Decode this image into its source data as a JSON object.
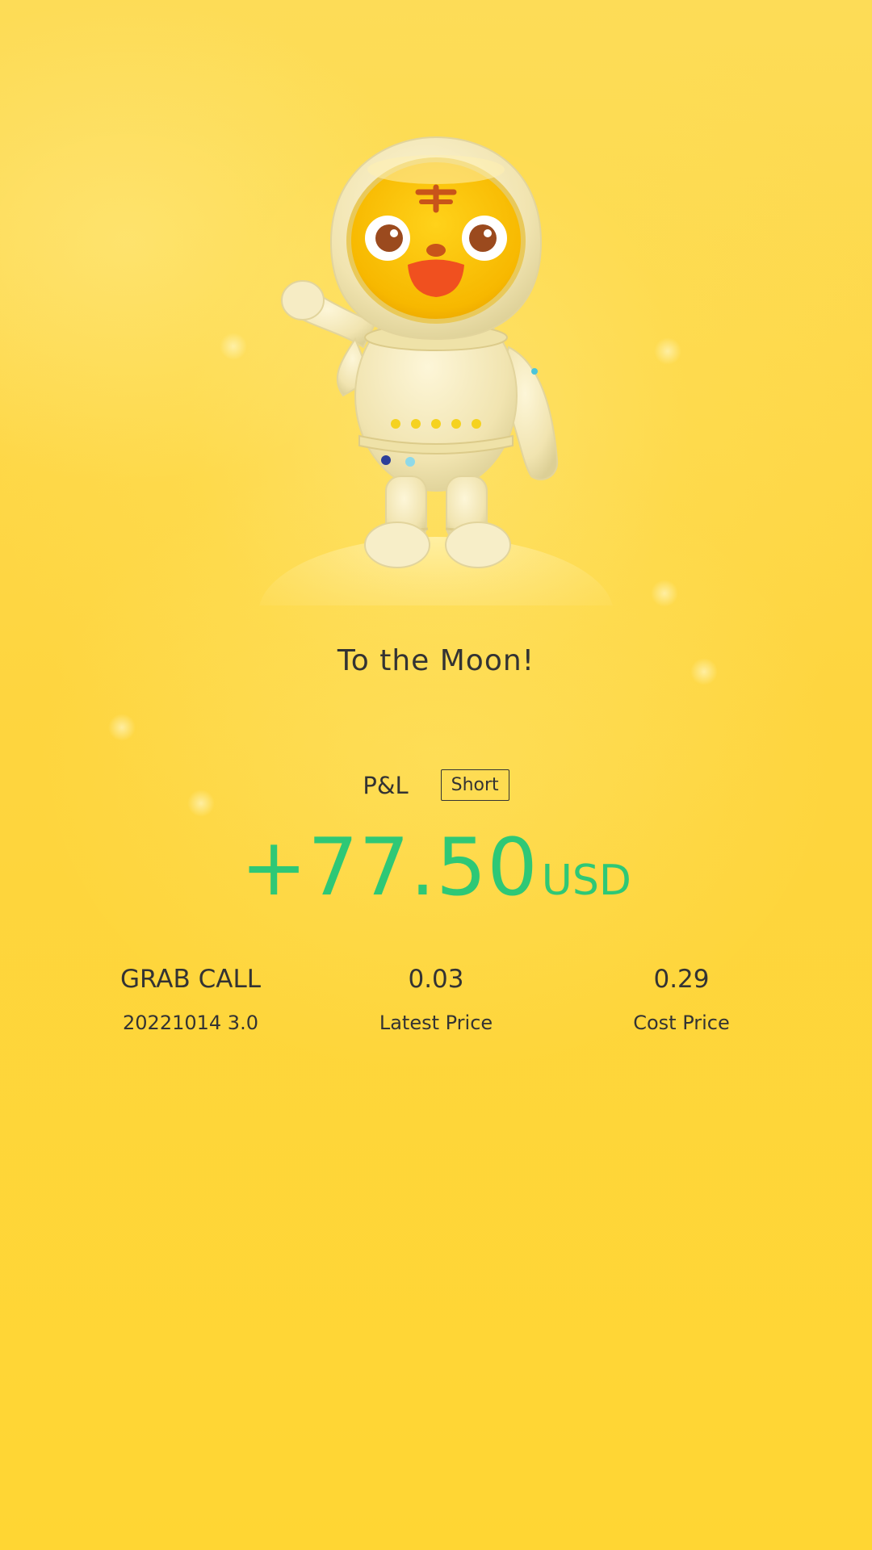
{
  "tagline": "To the Moon!",
  "position": {
    "pnl_label": "P&L",
    "direction": "Short",
    "pnl_value": "+77.50",
    "pnl_currency": "USD",
    "pnl_color": "#2ec876"
  },
  "stats": [
    {
      "value": "GRAB CALL",
      "label": "20221014 3.0"
    },
    {
      "value": "0.03",
      "label": "Latest Price"
    },
    {
      "value": "0.29",
      "label": "Cost Price"
    }
  ],
  "illustration": {
    "icon": "astronaut-tiger-mascot-icon"
  },
  "colors": {
    "background": "#fed53f",
    "text": "#333333",
    "profit": "#2ec876"
  }
}
